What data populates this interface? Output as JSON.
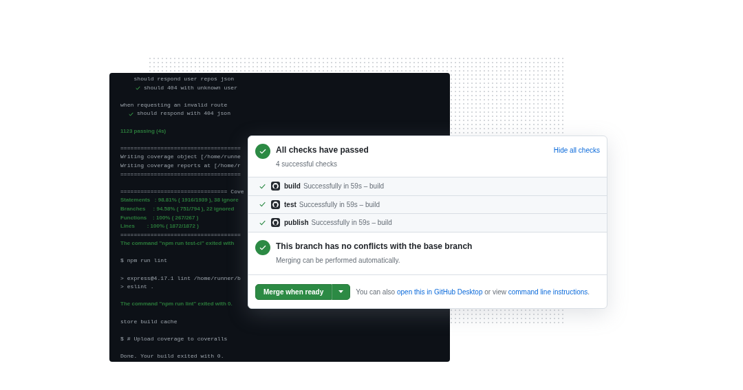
{
  "terminal": {
    "blocks": [
      {
        "lines": [
          {
            "kind": "plain",
            "text": "    should respond user repos json"
          },
          {
            "kind": "pass_deep",
            "text": "should 404 with unknown user"
          }
        ]
      },
      {
        "lines": [
          {
            "kind": "plain",
            "text": "when requesting an invalid route"
          },
          {
            "kind": "pass",
            "text": "should respond with 404 json"
          }
        ]
      },
      {
        "lines": [
          {
            "kind": "green",
            "text": "1123 passing (4s)"
          }
        ]
      },
      {
        "lines": [
          {
            "kind": "plain",
            "text": "===================================="
          },
          {
            "kind": "plain",
            "text": "Writing coverage object [/home/runne"
          },
          {
            "kind": "plain",
            "text": "Writing coverage reports at [/home/r"
          },
          {
            "kind": "plain",
            "text": "===================================="
          }
        ]
      },
      {
        "lines": [
          {
            "kind": "plain",
            "text": "================================ Cove"
          },
          {
            "kind": "green",
            "text": "Statements   : 98.81% ( 1916/1939 ), 38 ignore"
          },
          {
            "kind": "green",
            "text": "Branches     : 94.58% ( 751/794 ), 22 ignored"
          },
          {
            "kind": "green",
            "text": "Functions    : 100% ( 267/267 )"
          },
          {
            "kind": "green",
            "text": "Lines        : 100% ( 1872/1872 )"
          },
          {
            "kind": "plain",
            "text": "===================================="
          },
          {
            "kind": "green",
            "text": "The command \"npm run test-ci\" exited with"
          }
        ]
      },
      {
        "lines": [
          {
            "kind": "plain",
            "text": "$ npm run lint"
          }
        ]
      },
      {
        "lines": [
          {
            "kind": "plain",
            "text": "> express@4.17.1 lint /home/runner/b"
          },
          {
            "kind": "plain",
            "text": "> eslint ."
          }
        ]
      },
      {
        "lines": [
          {
            "kind": "green",
            "text": "The command \"npm run lint\" exited with 0."
          }
        ]
      },
      {
        "lines": [
          {
            "kind": "plain",
            "text": "store build cache"
          }
        ]
      },
      {
        "lines": [
          {
            "kind": "plain",
            "text": "$ # Upload coverage to coveralls"
          }
        ]
      },
      {
        "lines": [
          {
            "kind": "plain",
            "text": "Done. Your build exited with 0."
          }
        ]
      }
    ]
  },
  "merge_box": {
    "checks_header": {
      "success": true,
      "title": "All checks have passed",
      "subtitle": "4 successful checks"
    },
    "hide_link": "Hide all checks",
    "checks": [
      {
        "passed": true,
        "name": "build",
        "description": "Successfully in 59s – build"
      },
      {
        "passed": true,
        "name": "test",
        "description": "Successfully in 59s – build"
      },
      {
        "passed": true,
        "name": "publish",
        "description": "Successfully in 59s – build"
      }
    ],
    "conflicts": {
      "success": true,
      "title": "This branch has no conflicts with the base branch",
      "subtitle": "Merging can be performed automatically."
    },
    "merge_button": "Merge when ready",
    "footer": {
      "prefix": "You can also",
      "link_1": "open this in GitHub Desktop",
      "middle": "or view",
      "link_2": "command line instructions",
      "suffix": "."
    }
  }
}
